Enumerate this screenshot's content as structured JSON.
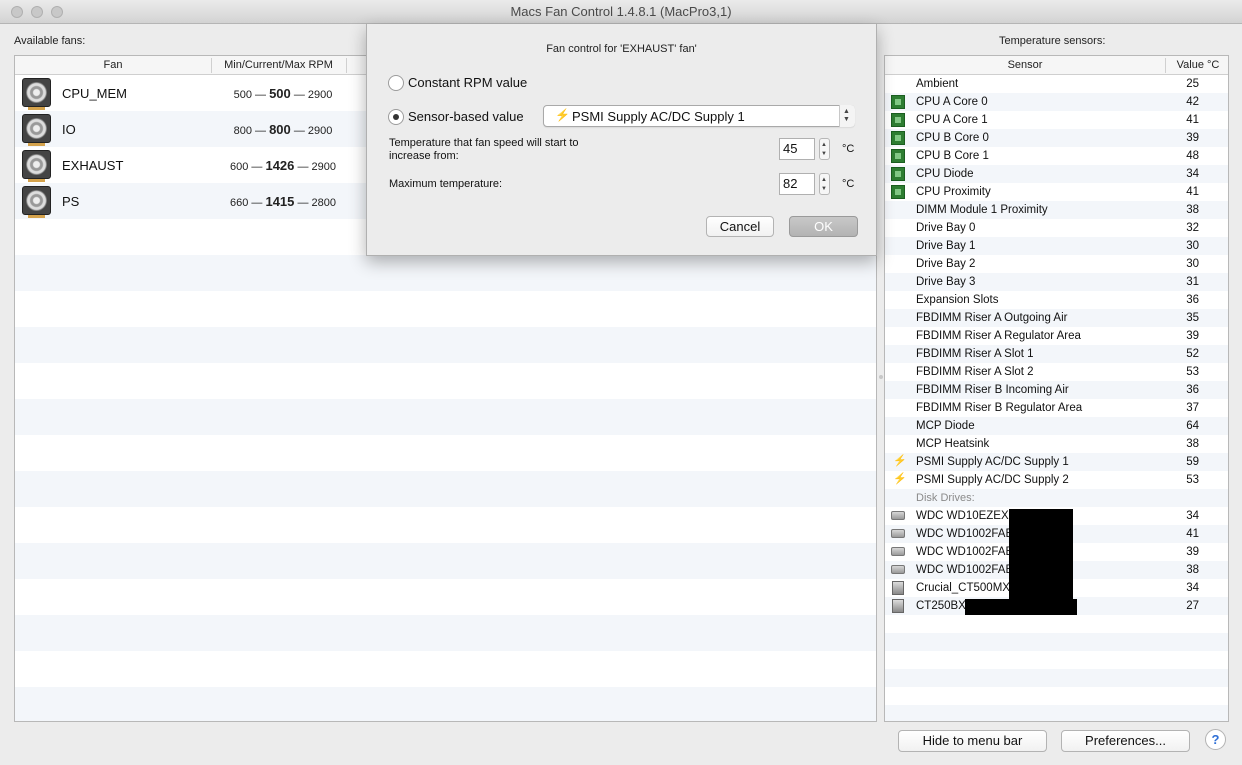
{
  "window": {
    "title": "Macs Fan Control 1.4.8.1 (MacPro3,1)"
  },
  "fans_section": {
    "label": "Available fans:",
    "headers": {
      "fan": "Fan",
      "rpm": "Min/Current/Max RPM"
    },
    "rows": [
      {
        "name": "CPU_MEM",
        "min": "500",
        "current": "500",
        "max": "2900"
      },
      {
        "name": "IO",
        "min": "800",
        "current": "800",
        "max": "2900"
      },
      {
        "name": "EXHAUST",
        "min": "600",
        "current": "1426",
        "max": "2900"
      },
      {
        "name": "PS",
        "min": "660",
        "current": "1415",
        "max": "2800"
      }
    ],
    "separator": "—"
  },
  "sensors_section": {
    "label": "Temperature sensors:",
    "headers": {
      "sensor": "Sensor",
      "value": "Value °C"
    },
    "rows": [
      {
        "icon": "none",
        "name": "Ambient",
        "value": "25"
      },
      {
        "icon": "cpu-chip-icon",
        "name": "CPU A Core 0",
        "value": "42"
      },
      {
        "icon": "cpu-chip-icon",
        "name": "CPU A Core 1",
        "value": "41"
      },
      {
        "icon": "cpu-chip-icon",
        "name": "CPU B Core 0",
        "value": "39"
      },
      {
        "icon": "cpu-chip-icon",
        "name": "CPU B Core 1",
        "value": "48"
      },
      {
        "icon": "cpu-chip-icon",
        "name": "CPU Diode",
        "value": "34"
      },
      {
        "icon": "cpu-chip-icon",
        "name": "CPU Proximity",
        "value": "41"
      },
      {
        "icon": "none",
        "name": "DIMM Module 1 Proximity",
        "value": "38"
      },
      {
        "icon": "none",
        "name": "Drive Bay 0",
        "value": "32"
      },
      {
        "icon": "none",
        "name": "Drive Bay 1",
        "value": "30"
      },
      {
        "icon": "none",
        "name": "Drive Bay 2",
        "value": "30"
      },
      {
        "icon": "none",
        "name": "Drive Bay 3",
        "value": "31"
      },
      {
        "icon": "none",
        "name": "Expansion Slots",
        "value": "36"
      },
      {
        "icon": "none",
        "name": "FBDIMM Riser A Outgoing Air",
        "value": "35"
      },
      {
        "icon": "none",
        "name": "FBDIMM Riser A Regulator Area",
        "value": "39"
      },
      {
        "icon": "none",
        "name": "FBDIMM Riser A Slot 1",
        "value": "52"
      },
      {
        "icon": "none",
        "name": "FBDIMM Riser A Slot 2",
        "value": "53"
      },
      {
        "icon": "none",
        "name": "FBDIMM Riser B Incoming Air",
        "value": "36"
      },
      {
        "icon": "none",
        "name": "FBDIMM Riser B Regulator Area",
        "value": "37"
      },
      {
        "icon": "none",
        "name": "MCP Diode",
        "value": "64"
      },
      {
        "icon": "none",
        "name": "MCP Heatsink",
        "value": "38"
      },
      {
        "icon": "power-bolt-icon",
        "name": "PSMI Supply AC/DC Supply 1",
        "value": "59"
      },
      {
        "icon": "power-bolt-icon",
        "name": "PSMI Supply AC/DC Supply 2",
        "value": "53"
      }
    ],
    "disk_group_label": "Disk Drives:",
    "disks": [
      {
        "icon": "hard-drive-icon",
        "name": "WDC WD10EZEX-",
        "value": "34"
      },
      {
        "icon": "hard-drive-icon",
        "name": "WDC WD1002FAE",
        "value": "41"
      },
      {
        "icon": "hard-drive-icon",
        "name": "WDC WD1002FAE",
        "value": "39"
      },
      {
        "icon": "hard-drive-icon",
        "name": "WDC WD1002FAE",
        "value": "38"
      },
      {
        "icon": "ssd-icon",
        "name": "Crucial_CT500MX",
        "value": "34"
      },
      {
        "icon": "ssd-icon",
        "name": "CT250BX",
        "value": "27"
      }
    ]
  },
  "footer": {
    "hide_label": "Hide to menu bar",
    "prefs_label": "Preferences...",
    "help_label": "?"
  },
  "dialog": {
    "title": "Fan control for 'EXHAUST' fan'",
    "constant_label": "Constant RPM value",
    "sensor_label": "Sensor-based value",
    "selected_mode": "sensor",
    "selected_sensor": "PSMI Supply AC/DC Supply 1",
    "start_temp_label": "Temperature that fan speed will start to increase from:",
    "start_temp_value": "45",
    "max_temp_label": "Maximum temperature:",
    "max_temp_value": "82",
    "unit": "°C",
    "cancel_label": "Cancel",
    "ok_label": "OK"
  }
}
